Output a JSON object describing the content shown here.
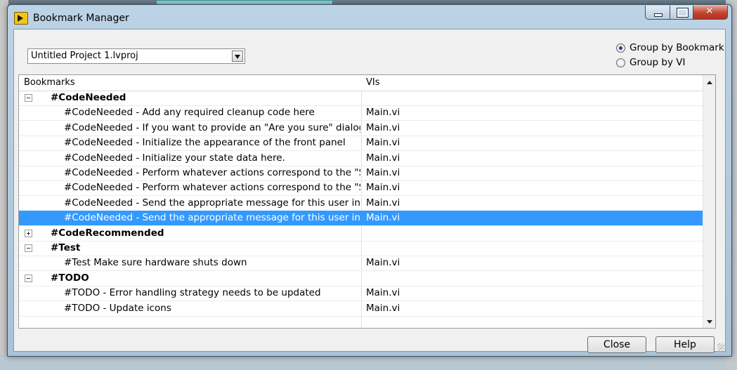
{
  "window": {
    "title": "Bookmark Manager"
  },
  "project": {
    "selected": "Untitled Project 1.lvproj"
  },
  "grouping": {
    "by_bookmark": "Group by Bookmark",
    "by_vi": "Group by VI",
    "selected": "by_bookmark"
  },
  "table": {
    "headers": {
      "bookmarks": "Bookmarks",
      "vis": "VIs"
    },
    "rows": [
      {
        "type": "group",
        "label": "#CodeNeeded",
        "vi": "",
        "expanded": true
      },
      {
        "type": "item",
        "label": "#CodeNeeded - Add any required cleanup code here",
        "vi": "Main.vi"
      },
      {
        "type": "item",
        "label": "#CodeNeeded - If you want to provide an \"Are you sure\" dialog (or",
        "vi": "Main.vi"
      },
      {
        "type": "item",
        "label": "#CodeNeeded - Initialize the appearance of the front panel",
        "vi": "Main.vi"
      },
      {
        "type": "item",
        "label": "#CodeNeeded - Initialize your state data here.",
        "vi": "Main.vi"
      },
      {
        "type": "item",
        "label": "#CodeNeeded - Perform whatever actions correspond to the \"Some",
        "vi": "Main.vi"
      },
      {
        "type": "item",
        "label": "#CodeNeeded - Perform whatever actions correspond to the \"Some",
        "vi": "Main.vi"
      },
      {
        "type": "item",
        "label": "#CodeNeeded - Send the appropriate message for this user interfac",
        "vi": "Main.vi"
      },
      {
        "type": "item",
        "label": "#CodeNeeded - Send the appropriate message for this user interfac",
        "vi": "Main.vi",
        "selected": true
      },
      {
        "type": "group",
        "label": "#CodeRecommended",
        "vi": "",
        "expanded": false
      },
      {
        "type": "group",
        "label": "#Test",
        "vi": "",
        "expanded": true
      },
      {
        "type": "item",
        "label": "#Test Make sure hardware shuts down",
        "vi": "Main.vi"
      },
      {
        "type": "group",
        "label": "#TODO",
        "vi": "",
        "expanded": true
      },
      {
        "type": "item",
        "label": "#TODO - Error handling strategy needs to be updated",
        "vi": "Main.vi"
      },
      {
        "type": "item",
        "label": "#TODO - Update icons",
        "vi": "Main.vi"
      }
    ]
  },
  "buttons": {
    "close": "Close",
    "help": "Help"
  },
  "colors": {
    "selection": "#3399ff",
    "titlebar": "#bcd3e6"
  }
}
